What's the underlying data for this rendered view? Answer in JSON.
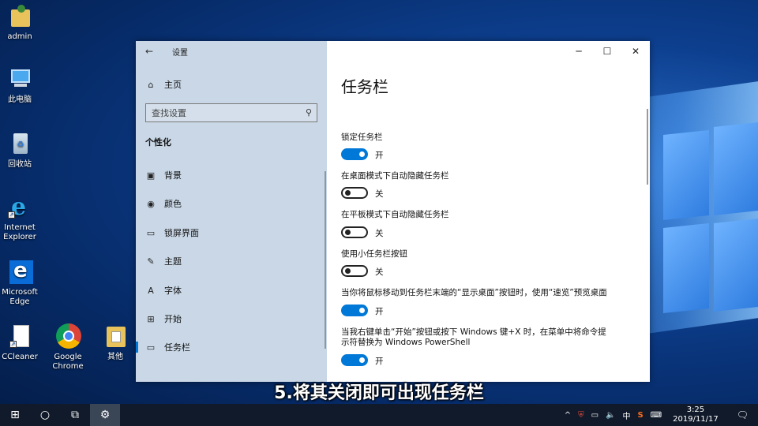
{
  "desktop": {
    "icons": [
      {
        "label": "admin"
      },
      {
        "label": "此电脑"
      },
      {
        "label": "回收站"
      },
      {
        "label": "Internet Explorer"
      },
      {
        "label": "Microsoft Edge"
      },
      {
        "label": "CCleaner"
      },
      {
        "label": "Google Chrome"
      },
      {
        "label": "其他"
      }
    ]
  },
  "window": {
    "title": "设置",
    "sidebar": {
      "home_label": "主页",
      "search_placeholder": "查找设置",
      "group_title": "个性化",
      "items": [
        {
          "label": "背景",
          "icon": "image-icon"
        },
        {
          "label": "颜色",
          "icon": "palette-icon"
        },
        {
          "label": "锁屏界面",
          "icon": "lock-screen-icon"
        },
        {
          "label": "主题",
          "icon": "theme-icon"
        },
        {
          "label": "字体",
          "icon": "font-icon"
        },
        {
          "label": "开始",
          "icon": "start-icon"
        },
        {
          "label": "任务栏",
          "icon": "taskbar-icon",
          "active": true
        }
      ]
    },
    "main": {
      "title": "任务栏",
      "settings": [
        {
          "label": "锁定任务栏",
          "state": "开",
          "on": true
        },
        {
          "label": "在桌面模式下自动隐藏任务栏",
          "state": "关",
          "on": false
        },
        {
          "label": "在平板模式下自动隐藏任务栏",
          "state": "关",
          "on": false
        },
        {
          "label": "使用小任务栏按钮",
          "state": "关",
          "on": false
        },
        {
          "label": "当你将鼠标移动到任务栏末端的“显示桌面”按钮时，使用“速览”预览桌面",
          "state": "开",
          "on": true
        },
        {
          "label": "当我右键单击“开始”按钮或按下 Windows 键+X 时，在菜单中将命令提示符替换为 Windows PowerShell",
          "state": "开",
          "on": true
        }
      ]
    }
  },
  "caption": "5.将其关闭即可出现任务栏",
  "taskbar": {
    "ime": "中",
    "time": "3:25",
    "date": "2019/11/17"
  },
  "colors": {
    "accent": "#0078d7",
    "sidebar_bg": "#c9d7e6",
    "taskbar_bg": "#101a2a"
  }
}
